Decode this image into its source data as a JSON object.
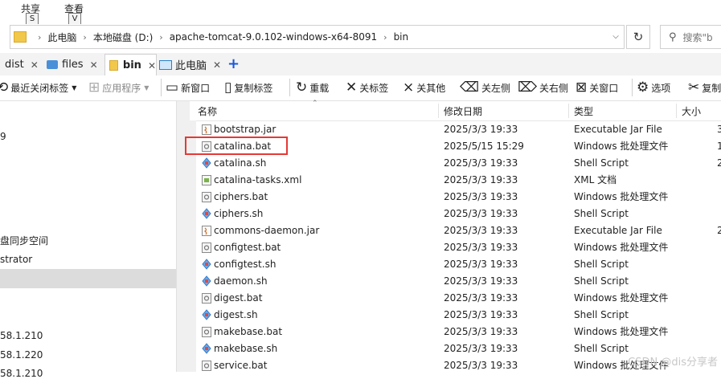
{
  "ribbon": {
    "tabs": [
      {
        "label": "共享",
        "key": "S"
      },
      {
        "label": "查看",
        "key": "V"
      }
    ]
  },
  "address": {
    "segments": [
      "此电脑",
      "本地磁盘 (D:)",
      "apache-tomcat-9.0.102-windows-x64-8091",
      "bin"
    ],
    "search_placeholder": "搜索\"b"
  },
  "tabs": [
    {
      "label": "dist"
    },
    {
      "label": "files"
    },
    {
      "label": "bin"
    },
    {
      "label": "此电脑"
    }
  ],
  "toolbar": {
    "recent_closed": "最近关闭标签",
    "apps": "应用程序",
    "new_window": "新窗口",
    "copy_tab": "复制标签",
    "reload": "重载",
    "close_tab": "关标签",
    "close_others": "关其他",
    "close_left": "关左侧",
    "close_right": "关右侧",
    "close_window": "关窗口",
    "options": "选项",
    "copy_partial": "复制"
  },
  "nav": {
    "items": [
      "9",
      "盘同步空间",
      "strator",
      "58.1.210",
      "58.1.220",
      "58.1.210"
    ]
  },
  "columns": {
    "name": "名称",
    "date": "修改日期",
    "type": "类型",
    "size": "大小"
  },
  "files": [
    {
      "name": "bootstrap.jar",
      "date": "2025/3/3 19:33",
      "type": "Executable Jar File",
      "size": "3",
      "icon": "jar-icon"
    },
    {
      "name": "catalina.bat",
      "date": "2025/5/15 15:29",
      "type": "Windows 批处理文件",
      "size": "1",
      "icon": "bat-icon"
    },
    {
      "name": "catalina.sh",
      "date": "2025/3/3 19:33",
      "type": "Shell Script",
      "size": "2",
      "icon": "sh-icon"
    },
    {
      "name": "catalina-tasks.xml",
      "date": "2025/3/3 19:33",
      "type": "XML 文档",
      "size": "",
      "icon": "xml-icon"
    },
    {
      "name": "ciphers.bat",
      "date": "2025/3/3 19:33",
      "type": "Windows 批处理文件",
      "size": "",
      "icon": "bat-icon"
    },
    {
      "name": "ciphers.sh",
      "date": "2025/3/3 19:33",
      "type": "Shell Script",
      "size": "",
      "icon": "sh-icon"
    },
    {
      "name": "commons-daemon.jar",
      "date": "2025/3/3 19:33",
      "type": "Executable Jar File",
      "size": "2",
      "icon": "jar-icon"
    },
    {
      "name": "configtest.bat",
      "date": "2025/3/3 19:33",
      "type": "Windows 批处理文件",
      "size": "",
      "icon": "bat-icon"
    },
    {
      "name": "configtest.sh",
      "date": "2025/3/3 19:33",
      "type": "Shell Script",
      "size": "",
      "icon": "sh-icon"
    },
    {
      "name": "daemon.sh",
      "date": "2025/3/3 19:33",
      "type": "Shell Script",
      "size": "",
      "icon": "sh-icon"
    },
    {
      "name": "digest.bat",
      "date": "2025/3/3 19:33",
      "type": "Windows 批处理文件",
      "size": "",
      "icon": "bat-icon"
    },
    {
      "name": "digest.sh",
      "date": "2025/3/3 19:33",
      "type": "Shell Script",
      "size": "",
      "icon": "sh-icon"
    },
    {
      "name": "makebase.bat",
      "date": "2025/3/3 19:33",
      "type": "Windows 批处理文件",
      "size": "",
      "icon": "bat-icon"
    },
    {
      "name": "makebase.sh",
      "date": "2025/3/3 19:33",
      "type": "Shell Script",
      "size": "",
      "icon": "sh-icon"
    },
    {
      "name": "service.bat",
      "date": "2025/3/3 19:33",
      "type": "Windows 批处理文件",
      "size": "",
      "icon": "bat-icon"
    }
  ],
  "watermark": "CSDN @dis分享者",
  "colors": {
    "highlight": "#e53935",
    "folder": "#f2c84b",
    "tab_add": "#1a56db"
  }
}
